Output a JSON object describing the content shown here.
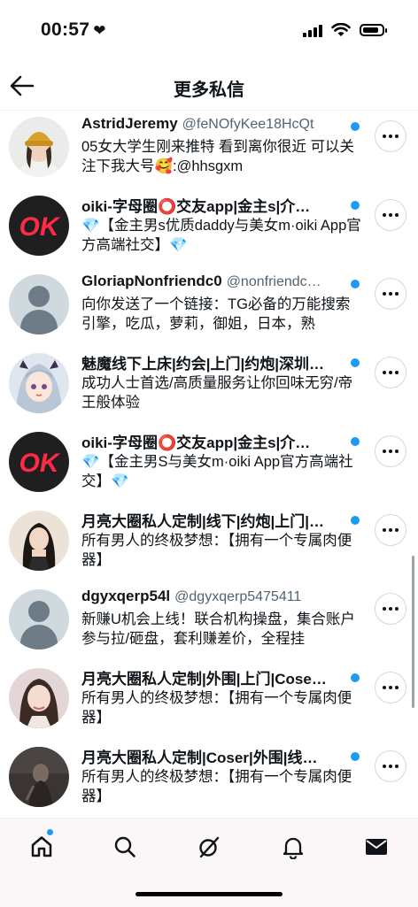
{
  "status_bar": {
    "time": "00:57",
    "heart": "❤",
    "battery_level": 0.85
  },
  "header": {
    "title": "更多私信",
    "back_icon": "arrow-left-icon"
  },
  "conversations": [
    {
      "name": "AstridJeremy",
      "handle": "@feNOfyKee18HcQt",
      "message": "05女大学生刚来推特 看到离你很近 可以关注下我大号🥰:@hhsgxm",
      "unread": true,
      "avatar": "photo-girl-beanie"
    },
    {
      "name": "oiki-字母圈⭕交友app|金主s|介…",
      "handle": "",
      "message": "💎【金主男s优质daddy与美女m·oiki App官方高端社交】💎",
      "unread": true,
      "avatar": "ok-logo"
    },
    {
      "name": "GloriapNonfriendc0",
      "handle": "@nonfriendc…",
      "message": "向你发送了一个链接：TG必备的万能搜索引擎，吃瓜，萝莉，御姐，日本，熟",
      "unread": true,
      "avatar": "default-profile"
    },
    {
      "name": "魅魔线下上床|约会|上门|约炮|深圳…",
      "handle": "",
      "message": "成功人士首选/高质量服务让你回味无穷/帝王般体验",
      "unread": true,
      "avatar": "anime-girl"
    },
    {
      "name": "oiki-字母圈⭕交友app|金主s|介…",
      "handle": "",
      "message": "💎【金主男S与美女m·oiki App官方高端社交】💎",
      "unread": true,
      "avatar": "ok-logo"
    },
    {
      "name": "月亮大圈私人定制|线下|约炮|上门|…",
      "handle": "",
      "message": "所有男人的终极梦想：【拥有一个专属肉便器】",
      "unread": true,
      "avatar": "photo-girl-long-hair"
    },
    {
      "name": "dgyxqerp54l",
      "handle": "@dgyxqerp5475411",
      "message": "新赚U机会上线！联合机构操盘，集合账户参与拉/砸盘，套利赚差价，全程挂",
      "unread": false,
      "avatar": "default-profile"
    },
    {
      "name": "月亮大圈私人定制|外围|上门|Cose…",
      "handle": "",
      "message": "所有男人的终极梦想：【拥有一个专属肉便器】",
      "unread": true,
      "avatar": "photo-girl-portrait"
    },
    {
      "name": "月亮大圈私人定制|Coser|外围|线…",
      "handle": "",
      "message": "所有男人的终极梦想：【拥有一个专属肉便器】",
      "unread": true,
      "avatar": "photo-dark"
    }
  ],
  "bottom_nav": [
    {
      "name": "home-icon",
      "active": true,
      "badge": true
    },
    {
      "name": "search-icon",
      "active": false
    },
    {
      "name": "grok-icon",
      "active": false
    },
    {
      "name": "bell-icon",
      "active": false
    },
    {
      "name": "mail-icon",
      "active": true
    }
  ],
  "colors": {
    "accent": "#1d9bf0",
    "text": "#0f1419",
    "secondary": "#536471"
  }
}
